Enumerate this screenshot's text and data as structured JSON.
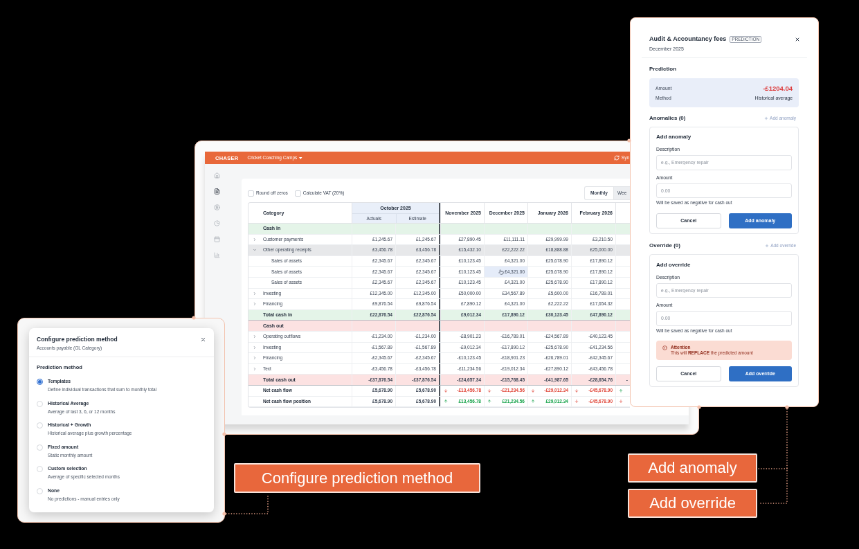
{
  "app_window": {
    "header": {
      "logo": "CHASER",
      "workspace": "Cricket Coaching Camps",
      "sync_label": "Syn"
    },
    "sidebar": {
      "items": [
        {
          "selected": false
        },
        {
          "selected": true
        },
        {
          "selected": false
        },
        {
          "selected": false
        },
        {
          "selected": false
        },
        {
          "selected": false
        }
      ]
    },
    "options": [
      {
        "label": "Round off zeros",
        "checked": false
      },
      {
        "label": "Calculate VAT (20%)",
        "checked": false
      }
    ],
    "view_toggle": [
      {
        "label": "Monthly",
        "selected": true
      },
      {
        "label": "Wee",
        "selected": false
      }
    ],
    "table": {
      "columns": {
        "category": "Category",
        "group": "October 2025",
        "group_columns": [
          "Actuals",
          "Estimate"
        ],
        "months": [
          "November 2025",
          "December 2025",
          "January 2026",
          "February 2026"
        ]
      },
      "rows": [
        {
          "kind": "section",
          "label": "Cash In",
          "color": "#e4f4e8"
        },
        {
          "kind": "item",
          "label": "Customer payments",
          "expanded": false,
          "cells": [
            {
              "value": "£1,245.67",
              "hovered": false
            },
            {
              "value": "£1,245.67",
              "hovered": false
            },
            {
              "value": "£27,890.45",
              "hovered": false
            },
            {
              "value": "£11,111.11",
              "hovered": false
            },
            {
              "value": "£29,999.99",
              "hovered": false
            },
            {
              "value": "£3,210.50",
              "hovered": false
            }
          ]
        },
        {
          "kind": "item",
          "label": "Other operating receipts",
          "expanded": true,
          "cells": [
            {
              "value": "£3,456.78",
              "hovered": false
            },
            {
              "value": "£3,456.78",
              "hovered": false
            },
            {
              "value": "£15,432.10",
              "hovered": false
            },
            {
              "value": "£22,222.22",
              "hovered": false
            },
            {
              "value": "£18,888.88",
              "hovered": false
            },
            {
              "value": "£25,000.00",
              "hovered": false
            }
          ]
        },
        {
          "kind": "child",
          "label": "Sales of assets",
          "cells": [
            {
              "value": "£2,345.67",
              "hovered": false
            },
            {
              "value": "£2,345.67",
              "hovered": false
            },
            {
              "value": "£10,123.45",
              "hovered": false
            },
            {
              "value": "£4,321.00",
              "hovered": false
            },
            {
              "value": "£25,678.90",
              "hovered": false
            },
            {
              "value": "£17,890.12",
              "hovered": false
            }
          ]
        },
        {
          "kind": "child",
          "label": "Sales of assets",
          "cells": [
            {
              "value": "£2,345.67",
              "hovered": false
            },
            {
              "value": "£2,345.67",
              "hovered": false
            },
            {
              "value": "£10,123.45",
              "hovered": false
            },
            {
              "value": "£4,321.00",
              "hovered": true
            },
            {
              "value": "£25,678.90",
              "hovered": false
            },
            {
              "value": "£17,890.12",
              "hovered": false
            }
          ]
        },
        {
          "kind": "child",
          "label": "Sales of assets",
          "cells": [
            {
              "value": "£2,345.67",
              "hovered": false
            },
            {
              "value": "£2,345.67",
              "hovered": false
            },
            {
              "value": "£10,123.45",
              "hovered": false
            },
            {
              "value": "£4,321.00",
              "hovered": false
            },
            {
              "value": "£25,678.90",
              "hovered": false
            },
            {
              "value": "£17,890.12",
              "hovered": false
            }
          ]
        },
        {
          "kind": "item",
          "label": "Investing",
          "expanded": false,
          "cells": [
            {
              "value": "£12,345.00",
              "hovered": false
            },
            {
              "value": "£12,345.00",
              "hovered": false
            },
            {
              "value": "£50,000.00",
              "hovered": false
            },
            {
              "value": "£34,567.89",
              "hovered": false
            },
            {
              "value": "£5,600.00",
              "hovered": false
            },
            {
              "value": "£16,789.01",
              "hovered": false
            }
          ]
        },
        {
          "kind": "item",
          "label": "Financing",
          "expanded": false,
          "cells": [
            {
              "value": "£9,876.54",
              "hovered": false
            },
            {
              "value": "£9,876.54",
              "hovered": false
            },
            {
              "value": "£7,890.12",
              "hovered": false
            },
            {
              "value": "£4,321.00",
              "hovered": false
            },
            {
              "value": "£2,222.22",
              "hovered": false
            },
            {
              "value": "£17,654.32",
              "hovered": false
            }
          ]
        },
        {
          "kind": "total",
          "label": "Total cash in",
          "color": "#e4f4e8",
          "cells": [
            {
              "value": "£22,876.54",
              "hovered": false
            },
            {
              "value": "£22,876.54",
              "hovered": false
            },
            {
              "value": "£9,012.34",
              "hovered": false
            },
            {
              "value": "£17,890.12",
              "hovered": false
            },
            {
              "value": "£30,123.45",
              "hovered": false
            },
            {
              "value": "£47,890.12",
              "hovered": false
            }
          ]
        },
        {
          "kind": "section",
          "label": "Cash out",
          "color": "#fce2e2"
        },
        {
          "kind": "item",
          "label": "Operating outflows",
          "expanded": false,
          "cells": [
            {
              "value": "-£1,234.00",
              "hovered": false
            },
            {
              "value": "-£1,234.00",
              "hovered": false
            },
            {
              "value": "-£8,901.23",
              "hovered": false
            },
            {
              "value": "-£16,789.01",
              "hovered": false
            },
            {
              "value": "-£24,567.89",
              "hovered": false
            },
            {
              "value": "-£40,123.45",
              "hovered": false
            }
          ]
        },
        {
          "kind": "item",
          "label": "Investing",
          "expanded": false,
          "cells": [
            {
              "value": "-£1,567.89",
              "hovered": false
            },
            {
              "value": "-£1,567.89",
              "hovered": false
            },
            {
              "value": "-£9,012.34",
              "hovered": false
            },
            {
              "value": "-£17,890.12",
              "hovered": false
            },
            {
              "value": "-£25,678.90",
              "hovered": false
            },
            {
              "value": "-£41,234.56",
              "hovered": false
            }
          ]
        },
        {
          "kind": "item",
          "label": "Financing",
          "expanded": false,
          "cells": [
            {
              "value": "-£2,345.67",
              "hovered": false
            },
            {
              "value": "-£2,345.67",
              "hovered": false
            },
            {
              "value": "-£10,123.45",
              "hovered": false
            },
            {
              "value": "-£18,901.23",
              "hovered": false
            },
            {
              "value": "-£26,789.01",
              "hovered": false
            },
            {
              "value": "-£42,345.67",
              "hovered": false
            }
          ]
        },
        {
          "kind": "item",
          "label": "Text",
          "expanded": false,
          "cells": [
            {
              "value": "-£3,456.78",
              "hovered": false
            },
            {
              "value": "-£3,456.78",
              "hovered": false
            },
            {
              "value": "-£11,234.56",
              "hovered": false
            },
            {
              "value": "-£19,012.34",
              "hovered": false
            },
            {
              "value": "-£27,890.12",
              "hovered": false
            },
            {
              "value": "-£43,456.78",
              "hovered": false
            }
          ]
        },
        {
          "kind": "total",
          "label": "Total cash out",
          "color": "#fce2e2",
          "cells": [
            {
              "value": "-£37,876.54",
              "hovered": false
            },
            {
              "value": "-£37,876.54",
              "hovered": false
            },
            {
              "value": "-£24,657.34",
              "hovered": false
            },
            {
              "value": "-£15,768.45",
              "hovered": false
            },
            {
              "value": "-£41,987.65",
              "hovered": false
            },
            {
              "value": "-£28,654.76",
              "hovered": false
            },
            {
              "value": "-",
              "hovered": false
            }
          ]
        },
        {
          "kind": "net",
          "label": "Net cash flow",
          "cells": [
            {
              "value": "£5,678.90",
              "hovered": false
            },
            {
              "value": "£5,678.90",
              "hovered": false
            },
            {
              "value": "-£13,456.78",
              "rising": false,
              "hovered": false
            },
            {
              "value": "-£21,234.56",
              "rising": false,
              "hovered": false
            },
            {
              "value": "-£29,012.34",
              "rising": false,
              "hovered": false
            },
            {
              "value": "-£45,678.90",
              "rising": false,
              "hovered": false
            },
            {
              "rising": true,
              "hovered": false
            }
          ]
        },
        {
          "kind": "net",
          "label": "Net cash flow position",
          "cells": [
            {
              "value": "£5,678.90",
              "hovered": false
            },
            {
              "value": "£5,678.90",
              "hovered": false
            },
            {
              "value": "£13,456.78",
              "rising": true,
              "hovered": false
            },
            {
              "value": "£21,234.56",
              "rising": true,
              "hovered": false
            },
            {
              "value": "£29,012.34",
              "rising": true,
              "hovered": false
            },
            {
              "value": "-£45,678.90",
              "rising": false,
              "hovered": false
            },
            {
              "rising": false,
              "hovered": false
            }
          ]
        }
      ]
    }
  },
  "prediction_method_dialog": {
    "title": "Configure prediction method",
    "subtitle": "Accounts payable (GL Category)",
    "heading": "Prediction method",
    "options": [
      {
        "label": "Templates",
        "description": "Define individual transactions that sum to monthly total",
        "selected": true
      },
      {
        "label": "Historical Average",
        "description": "Average of last 3, 6, or 12 months",
        "selected": false
      },
      {
        "label": "Historical + Growth",
        "description": "Historical average plus growth percentage",
        "selected": false
      },
      {
        "label": "Fixed amount",
        "description": "Static monthly amount",
        "selected": false
      },
      {
        "label": "Custom selection",
        "description": "Average of specific selected months",
        "selected": false
      },
      {
        "label": "None",
        "description": "No predictions - manual entries only",
        "selected": false
      }
    ]
  },
  "prediction_panel": {
    "title": "Audit & Accountancy fees",
    "badge": "PREDICTION",
    "subtitle": "December 2025",
    "prediction": {
      "heading": "Prediction",
      "fields": [
        {
          "label": "Amount",
          "value": "-£1204.04",
          "kind": "amount"
        },
        {
          "label": "Method",
          "value": "Historical average",
          "kind": "text"
        }
      ]
    },
    "sections": [
      {
        "heading": "Anomalies (0)",
        "action": {
          "label": "Add anomaly",
          "disabled": true
        },
        "form": {
          "title": "Add anomaly",
          "fields": [
            {
              "label": "Description",
              "placeholder": "e.g., Emergency repair"
            },
            {
              "label": "Amount",
              "placeholder": "0.00",
              "hint": "Will be saved as negative for cash out"
            }
          ],
          "buttons": [
            {
              "label": "Cancel",
              "kind": "secondary"
            },
            {
              "label": "Add anomaly",
              "kind": "primary"
            }
          ]
        }
      },
      {
        "heading": "Override (0)",
        "action": {
          "label": "Add override",
          "disabled": true
        },
        "form": {
          "title": "Add override",
          "fields": [
            {
              "label": "Description",
              "placeholder": "e.g., Emergency repair"
            },
            {
              "label": "Amount",
              "placeholder": "0.00",
              "hint": "Will be saved as negative for cash out"
            }
          ],
          "alert": {
            "title": "Attention",
            "text": "This will **REPLACE** the predicted amount"
          },
          "buttons": [
            {
              "label": "Cancel",
              "kind": "secondary"
            },
            {
              "label": "Add override",
              "kind": "primary"
            }
          ]
        }
      }
    ]
  },
  "callouts": [
    {
      "label": "Configure prediction method"
    },
    {
      "label": "Add anomaly"
    },
    {
      "label": "Add override"
    }
  ]
}
